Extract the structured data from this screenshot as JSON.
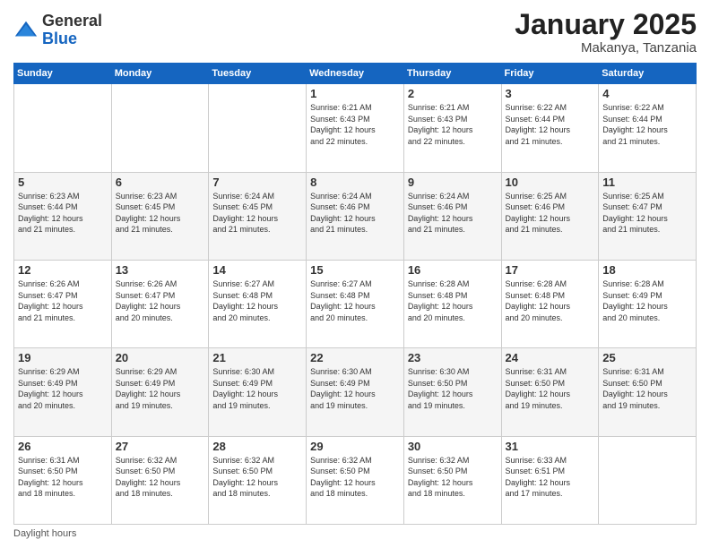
{
  "header": {
    "logo_general": "General",
    "logo_blue": "Blue",
    "month_title": "January 2025",
    "location": "Makanya, Tanzania"
  },
  "weekdays": [
    "Sunday",
    "Monday",
    "Tuesday",
    "Wednesday",
    "Thursday",
    "Friday",
    "Saturday"
  ],
  "weeks": [
    [
      {
        "day": "",
        "info": ""
      },
      {
        "day": "",
        "info": ""
      },
      {
        "day": "",
        "info": ""
      },
      {
        "day": "1",
        "info": "Sunrise: 6:21 AM\nSunset: 6:43 PM\nDaylight: 12 hours\nand 22 minutes."
      },
      {
        "day": "2",
        "info": "Sunrise: 6:21 AM\nSunset: 6:43 PM\nDaylight: 12 hours\nand 22 minutes."
      },
      {
        "day": "3",
        "info": "Sunrise: 6:22 AM\nSunset: 6:44 PM\nDaylight: 12 hours\nand 21 minutes."
      },
      {
        "day": "4",
        "info": "Sunrise: 6:22 AM\nSunset: 6:44 PM\nDaylight: 12 hours\nand 21 minutes."
      }
    ],
    [
      {
        "day": "5",
        "info": "Sunrise: 6:23 AM\nSunset: 6:44 PM\nDaylight: 12 hours\nand 21 minutes."
      },
      {
        "day": "6",
        "info": "Sunrise: 6:23 AM\nSunset: 6:45 PM\nDaylight: 12 hours\nand 21 minutes."
      },
      {
        "day": "7",
        "info": "Sunrise: 6:24 AM\nSunset: 6:45 PM\nDaylight: 12 hours\nand 21 minutes."
      },
      {
        "day": "8",
        "info": "Sunrise: 6:24 AM\nSunset: 6:46 PM\nDaylight: 12 hours\nand 21 minutes."
      },
      {
        "day": "9",
        "info": "Sunrise: 6:24 AM\nSunset: 6:46 PM\nDaylight: 12 hours\nand 21 minutes."
      },
      {
        "day": "10",
        "info": "Sunrise: 6:25 AM\nSunset: 6:46 PM\nDaylight: 12 hours\nand 21 minutes."
      },
      {
        "day": "11",
        "info": "Sunrise: 6:25 AM\nSunset: 6:47 PM\nDaylight: 12 hours\nand 21 minutes."
      }
    ],
    [
      {
        "day": "12",
        "info": "Sunrise: 6:26 AM\nSunset: 6:47 PM\nDaylight: 12 hours\nand 21 minutes."
      },
      {
        "day": "13",
        "info": "Sunrise: 6:26 AM\nSunset: 6:47 PM\nDaylight: 12 hours\nand 20 minutes."
      },
      {
        "day": "14",
        "info": "Sunrise: 6:27 AM\nSunset: 6:48 PM\nDaylight: 12 hours\nand 20 minutes."
      },
      {
        "day": "15",
        "info": "Sunrise: 6:27 AM\nSunset: 6:48 PM\nDaylight: 12 hours\nand 20 minutes."
      },
      {
        "day": "16",
        "info": "Sunrise: 6:28 AM\nSunset: 6:48 PM\nDaylight: 12 hours\nand 20 minutes."
      },
      {
        "day": "17",
        "info": "Sunrise: 6:28 AM\nSunset: 6:48 PM\nDaylight: 12 hours\nand 20 minutes."
      },
      {
        "day": "18",
        "info": "Sunrise: 6:28 AM\nSunset: 6:49 PM\nDaylight: 12 hours\nand 20 minutes."
      }
    ],
    [
      {
        "day": "19",
        "info": "Sunrise: 6:29 AM\nSunset: 6:49 PM\nDaylight: 12 hours\nand 20 minutes."
      },
      {
        "day": "20",
        "info": "Sunrise: 6:29 AM\nSunset: 6:49 PM\nDaylight: 12 hours\nand 19 minutes."
      },
      {
        "day": "21",
        "info": "Sunrise: 6:30 AM\nSunset: 6:49 PM\nDaylight: 12 hours\nand 19 minutes."
      },
      {
        "day": "22",
        "info": "Sunrise: 6:30 AM\nSunset: 6:49 PM\nDaylight: 12 hours\nand 19 minutes."
      },
      {
        "day": "23",
        "info": "Sunrise: 6:30 AM\nSunset: 6:50 PM\nDaylight: 12 hours\nand 19 minutes."
      },
      {
        "day": "24",
        "info": "Sunrise: 6:31 AM\nSunset: 6:50 PM\nDaylight: 12 hours\nand 19 minutes."
      },
      {
        "day": "25",
        "info": "Sunrise: 6:31 AM\nSunset: 6:50 PM\nDaylight: 12 hours\nand 19 minutes."
      }
    ],
    [
      {
        "day": "26",
        "info": "Sunrise: 6:31 AM\nSunset: 6:50 PM\nDaylight: 12 hours\nand 18 minutes."
      },
      {
        "day": "27",
        "info": "Sunrise: 6:32 AM\nSunset: 6:50 PM\nDaylight: 12 hours\nand 18 minutes."
      },
      {
        "day": "28",
        "info": "Sunrise: 6:32 AM\nSunset: 6:50 PM\nDaylight: 12 hours\nand 18 minutes."
      },
      {
        "day": "29",
        "info": "Sunrise: 6:32 AM\nSunset: 6:50 PM\nDaylight: 12 hours\nand 18 minutes."
      },
      {
        "day": "30",
        "info": "Sunrise: 6:32 AM\nSunset: 6:50 PM\nDaylight: 12 hours\nand 18 minutes."
      },
      {
        "day": "31",
        "info": "Sunrise: 6:33 AM\nSunset: 6:51 PM\nDaylight: 12 hours\nand 17 minutes."
      },
      {
        "day": "",
        "info": ""
      }
    ]
  ],
  "footer": {
    "daylight_label": "Daylight hours"
  }
}
